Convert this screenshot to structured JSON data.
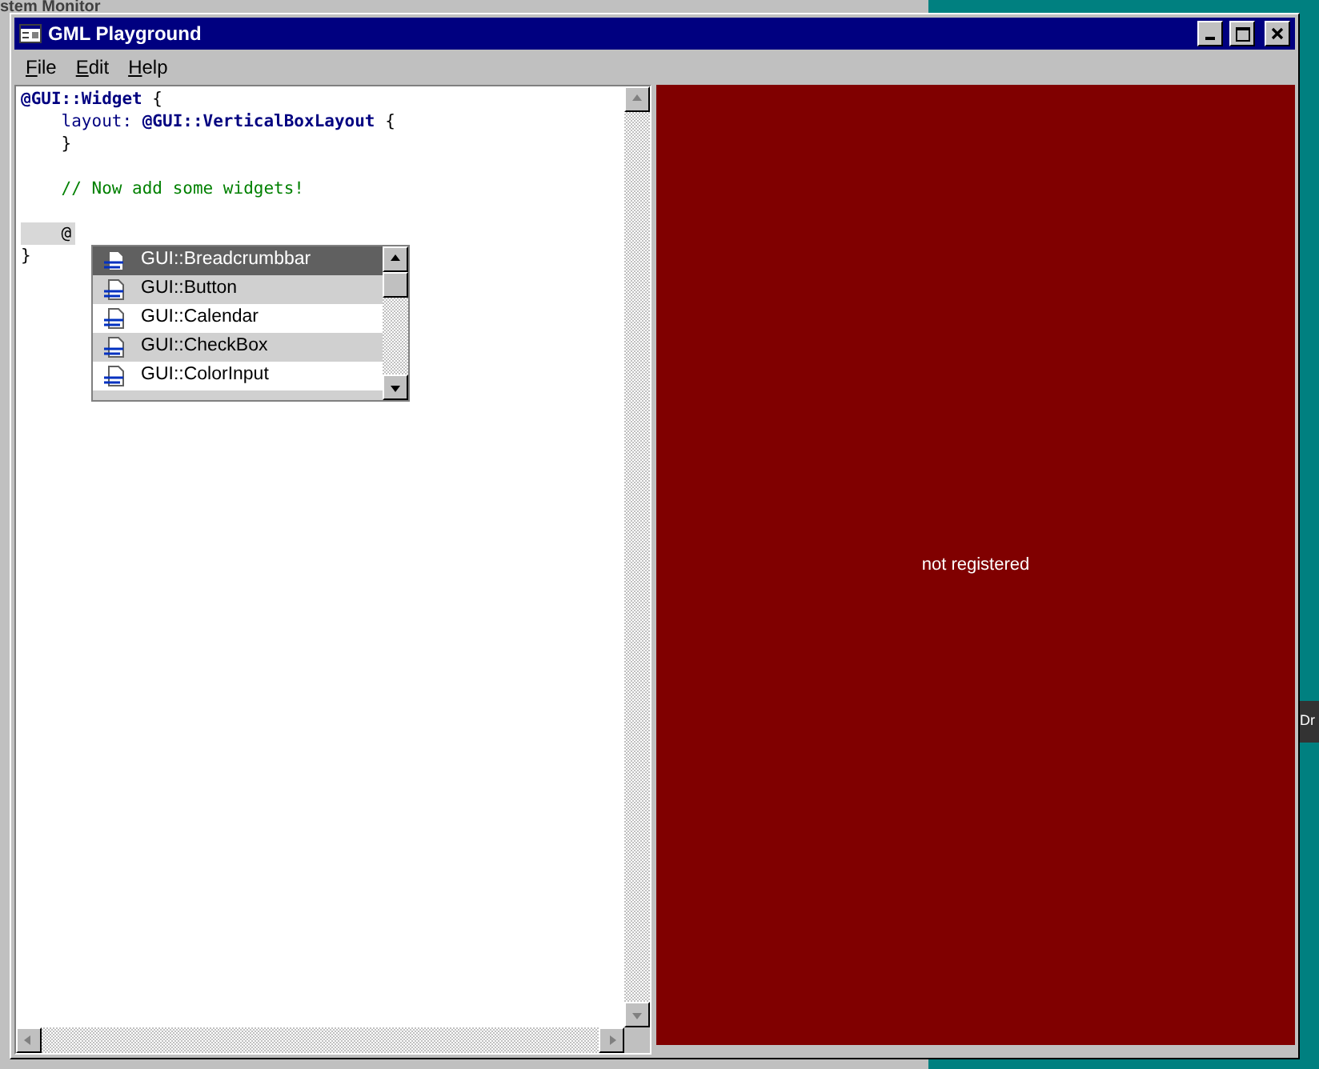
{
  "background": {
    "window_title": "stem Monitor",
    "fragment": "Dr"
  },
  "window": {
    "title": "GML Playground"
  },
  "menu": [
    {
      "label": "File"
    },
    {
      "label": "Edit"
    },
    {
      "label": "Help"
    }
  ],
  "editor": {
    "blocks": [
      {
        "lines": [
          {
            "current": false,
            "tokens": [
              {
                "kind": "type",
                "text": "@GUI::Widget"
              },
              {
                "kind": "plain",
                "text": " {"
              }
            ]
          },
          {
            "current": false,
            "tokens": [
              {
                "kind": "key",
                "text": "    layout: "
              },
              {
                "kind": "type",
                "text": "@GUI::VerticalBoxLayout"
              },
              {
                "kind": "plain",
                "text": " {"
              }
            ]
          },
          {
            "current": false,
            "tokens": [
              {
                "kind": "plain",
                "text": "    }"
              }
            ]
          }
        ]
      },
      {
        "lines": [
          {
            "current": false,
            "tokens": [
              {
                "kind": "comment",
                "text": "    // Now add some widgets!"
              }
            ]
          }
        ]
      },
      {
        "lines": [
          {
            "current": true,
            "tokens": [
              {
                "kind": "plain",
                "text": "    @"
              }
            ]
          },
          {
            "current": false,
            "tokens": [
              {
                "kind": "plain",
                "text": "}"
              }
            ]
          }
        ]
      }
    ]
  },
  "autocomplete": {
    "items": [
      {
        "label": "GUI::Breadcrumbbar",
        "selected": true
      },
      {
        "label": "GUI::Button",
        "selected": false
      },
      {
        "label": "GUI::Calendar",
        "selected": false
      },
      {
        "label": "GUI::CheckBox",
        "selected": false
      },
      {
        "label": "GUI::ColorInput",
        "selected": false
      }
    ]
  },
  "preview": {
    "message": "not registered"
  }
}
